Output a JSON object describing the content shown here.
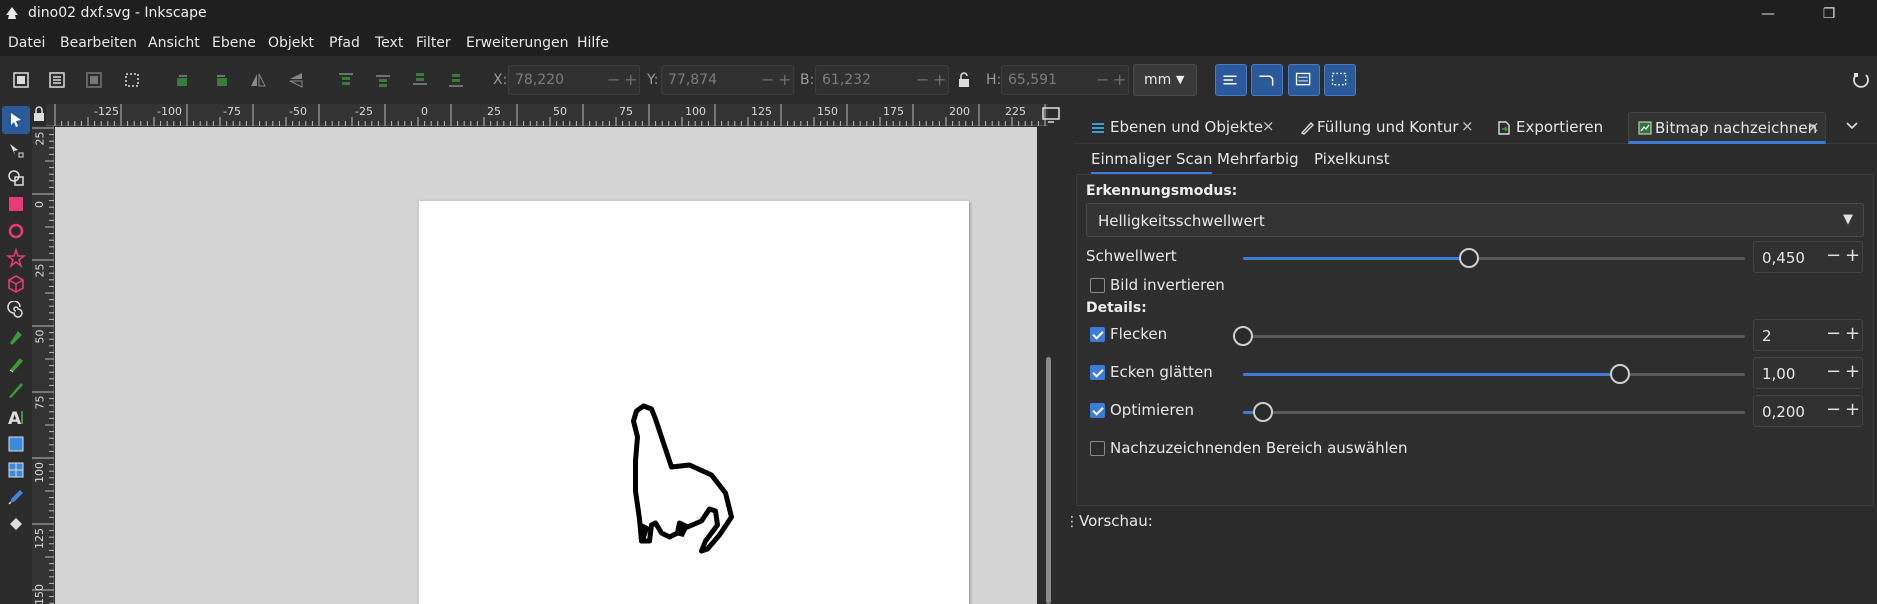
{
  "window": {
    "title": "dino02 dxf.svg - Inkscape"
  },
  "menu": [
    "Datei",
    "Bearbeiten",
    "Ansicht",
    "Ebene",
    "Objekt",
    "Pfad",
    "Text",
    "Filter",
    "Erweiterungen",
    "Hilfe"
  ],
  "coords": {
    "x_label": "X:",
    "x_value": "78,220",
    "y_label": "Y:",
    "y_value": "77,874",
    "w_label": "B:",
    "w_value": "61,232",
    "h_label": "H:",
    "h_value": "65,591",
    "unit": "mm"
  },
  "ruler": {
    "h_ticks": [
      "-125",
      "-100",
      "-75",
      "-50",
      "-25",
      "0",
      "25",
      "50",
      "75",
      "100",
      "125",
      "150",
      "175",
      "200",
      "225"
    ],
    "v_ticks": [
      "25",
      "0",
      "25",
      "50",
      "75",
      "100",
      "125",
      "150"
    ]
  },
  "dock": {
    "tabs": [
      {
        "label": "Ebenen und Objekte",
        "icon": "layers-icon"
      },
      {
        "label": "Füllung und Kontur",
        "icon": "fill-stroke-icon"
      },
      {
        "label": "Exportieren",
        "icon": "export-icon"
      },
      {
        "label": "Bitmap nachzeichnen",
        "icon": "trace-bitmap-icon"
      }
    ],
    "close_glyph": "×",
    "subtabs": [
      "Einmaliger Scan",
      "Mehrfarbig",
      "Pixelkunst"
    ],
    "mode_title": "Erkennungsmodus:",
    "mode_value": "Helligkeitsschwellwert",
    "threshold": {
      "label": "Schwellwert",
      "value": "0,450",
      "level": 0.45
    },
    "invert_label": "Bild invertieren",
    "details_title": "Details:",
    "speckles": {
      "label": "Flecken",
      "value": "2",
      "level": 0.0
    },
    "smooth": {
      "label": "Ecken glätten",
      "value": "1,00",
      "level": 0.75
    },
    "optimize": {
      "label": "Optimieren",
      "value": "0,200",
      "level": 0.04
    },
    "area_label": "Nachzuzeichnenden Bereich auswählen",
    "preview_label": "Vorschau:"
  },
  "colors": {
    "accent": "#3d7bd9",
    "canvas": "#d4d4d4"
  }
}
